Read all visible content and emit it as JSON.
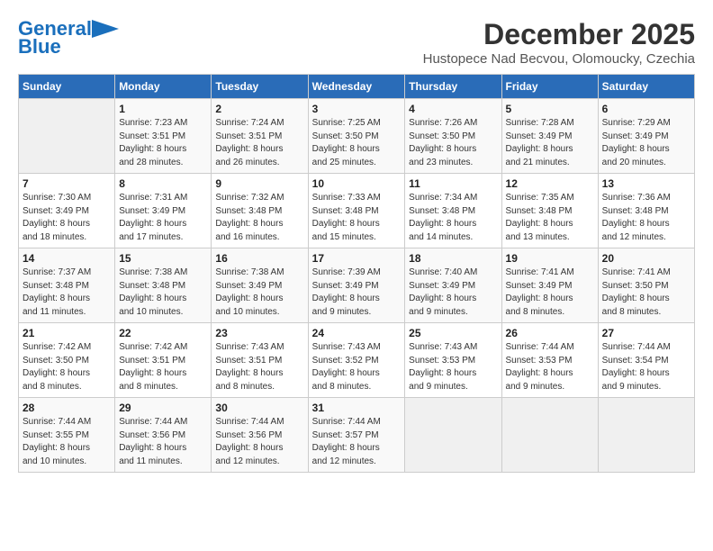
{
  "logo": {
    "line1": "General",
    "line2": "Blue"
  },
  "title": "December 2025",
  "subtitle": "Hustopece Nad Becvou, Olomoucky, Czechia",
  "headers": [
    "Sunday",
    "Monday",
    "Tuesday",
    "Wednesday",
    "Thursday",
    "Friday",
    "Saturday"
  ],
  "weeks": [
    [
      {
        "day": "",
        "info": ""
      },
      {
        "day": "1",
        "info": "Sunrise: 7:23 AM\nSunset: 3:51 PM\nDaylight: 8 hours\nand 28 minutes."
      },
      {
        "day": "2",
        "info": "Sunrise: 7:24 AM\nSunset: 3:51 PM\nDaylight: 8 hours\nand 26 minutes."
      },
      {
        "day": "3",
        "info": "Sunrise: 7:25 AM\nSunset: 3:50 PM\nDaylight: 8 hours\nand 25 minutes."
      },
      {
        "day": "4",
        "info": "Sunrise: 7:26 AM\nSunset: 3:50 PM\nDaylight: 8 hours\nand 23 minutes."
      },
      {
        "day": "5",
        "info": "Sunrise: 7:28 AM\nSunset: 3:49 PM\nDaylight: 8 hours\nand 21 minutes."
      },
      {
        "day": "6",
        "info": "Sunrise: 7:29 AM\nSunset: 3:49 PM\nDaylight: 8 hours\nand 20 minutes."
      }
    ],
    [
      {
        "day": "7",
        "info": "Sunrise: 7:30 AM\nSunset: 3:49 PM\nDaylight: 8 hours\nand 18 minutes."
      },
      {
        "day": "8",
        "info": "Sunrise: 7:31 AM\nSunset: 3:49 PM\nDaylight: 8 hours\nand 17 minutes."
      },
      {
        "day": "9",
        "info": "Sunrise: 7:32 AM\nSunset: 3:48 PM\nDaylight: 8 hours\nand 16 minutes."
      },
      {
        "day": "10",
        "info": "Sunrise: 7:33 AM\nSunset: 3:48 PM\nDaylight: 8 hours\nand 15 minutes."
      },
      {
        "day": "11",
        "info": "Sunrise: 7:34 AM\nSunset: 3:48 PM\nDaylight: 8 hours\nand 14 minutes."
      },
      {
        "day": "12",
        "info": "Sunrise: 7:35 AM\nSunset: 3:48 PM\nDaylight: 8 hours\nand 13 minutes."
      },
      {
        "day": "13",
        "info": "Sunrise: 7:36 AM\nSunset: 3:48 PM\nDaylight: 8 hours\nand 12 minutes."
      }
    ],
    [
      {
        "day": "14",
        "info": "Sunrise: 7:37 AM\nSunset: 3:48 PM\nDaylight: 8 hours\nand 11 minutes."
      },
      {
        "day": "15",
        "info": "Sunrise: 7:38 AM\nSunset: 3:48 PM\nDaylight: 8 hours\nand 10 minutes."
      },
      {
        "day": "16",
        "info": "Sunrise: 7:38 AM\nSunset: 3:49 PM\nDaylight: 8 hours\nand 10 minutes."
      },
      {
        "day": "17",
        "info": "Sunrise: 7:39 AM\nSunset: 3:49 PM\nDaylight: 8 hours\nand 9 minutes."
      },
      {
        "day": "18",
        "info": "Sunrise: 7:40 AM\nSunset: 3:49 PM\nDaylight: 8 hours\nand 9 minutes."
      },
      {
        "day": "19",
        "info": "Sunrise: 7:41 AM\nSunset: 3:49 PM\nDaylight: 8 hours\nand 8 minutes."
      },
      {
        "day": "20",
        "info": "Sunrise: 7:41 AM\nSunset: 3:50 PM\nDaylight: 8 hours\nand 8 minutes."
      }
    ],
    [
      {
        "day": "21",
        "info": "Sunrise: 7:42 AM\nSunset: 3:50 PM\nDaylight: 8 hours\nand 8 minutes."
      },
      {
        "day": "22",
        "info": "Sunrise: 7:42 AM\nSunset: 3:51 PM\nDaylight: 8 hours\nand 8 minutes."
      },
      {
        "day": "23",
        "info": "Sunrise: 7:43 AM\nSunset: 3:51 PM\nDaylight: 8 hours\nand 8 minutes."
      },
      {
        "day": "24",
        "info": "Sunrise: 7:43 AM\nSunset: 3:52 PM\nDaylight: 8 hours\nand 8 minutes."
      },
      {
        "day": "25",
        "info": "Sunrise: 7:43 AM\nSunset: 3:53 PM\nDaylight: 8 hours\nand 9 minutes."
      },
      {
        "day": "26",
        "info": "Sunrise: 7:44 AM\nSunset: 3:53 PM\nDaylight: 8 hours\nand 9 minutes."
      },
      {
        "day": "27",
        "info": "Sunrise: 7:44 AM\nSunset: 3:54 PM\nDaylight: 8 hours\nand 9 minutes."
      }
    ],
    [
      {
        "day": "28",
        "info": "Sunrise: 7:44 AM\nSunset: 3:55 PM\nDaylight: 8 hours\nand 10 minutes."
      },
      {
        "day": "29",
        "info": "Sunrise: 7:44 AM\nSunset: 3:56 PM\nDaylight: 8 hours\nand 11 minutes."
      },
      {
        "day": "30",
        "info": "Sunrise: 7:44 AM\nSunset: 3:56 PM\nDaylight: 8 hours\nand 12 minutes."
      },
      {
        "day": "31",
        "info": "Sunrise: 7:44 AM\nSunset: 3:57 PM\nDaylight: 8 hours\nand 12 minutes."
      },
      {
        "day": "",
        "info": ""
      },
      {
        "day": "",
        "info": ""
      },
      {
        "day": "",
        "info": ""
      }
    ]
  ]
}
